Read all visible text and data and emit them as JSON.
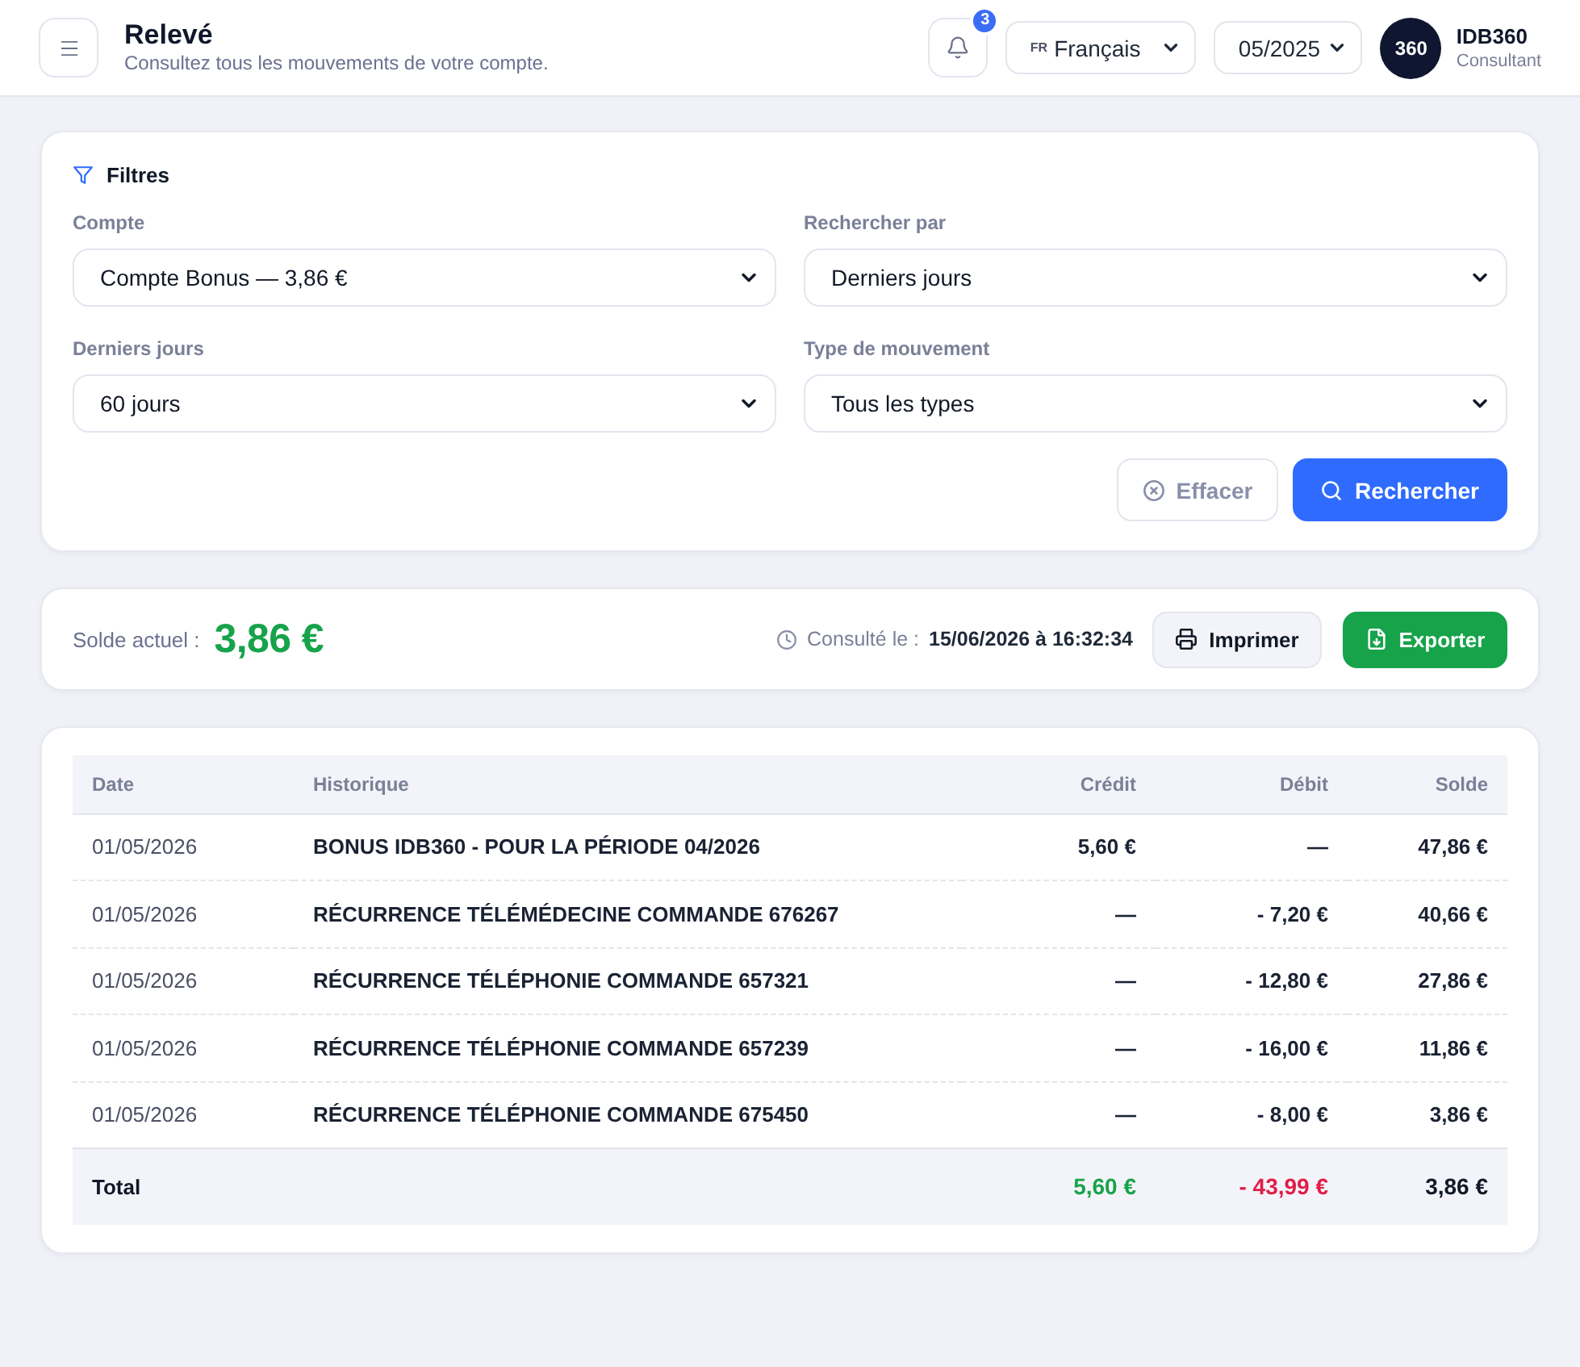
{
  "header": {
    "title": "Relevé",
    "subtitle": "Consultez tous les mouvements de votre compte.",
    "notifications": {
      "count": "3"
    },
    "language": {
      "code": "FR",
      "value": "Français"
    },
    "period": {
      "value": "05/2025"
    },
    "user": {
      "avatar": "360",
      "name": "IDB360",
      "role": "Consultant"
    }
  },
  "filters": {
    "title": "Filtres",
    "fields": [
      {
        "label": "Compte",
        "value": "Compte Bonus — 3,86 €"
      },
      {
        "label": "Rechercher par",
        "value": "Derniers jours"
      },
      {
        "label": "Derniers jours",
        "value": "60 jours"
      },
      {
        "label": "Type de mouvement",
        "value": "Tous les types"
      }
    ],
    "buttons": [
      {
        "label": "Effacer",
        "kind": "clear"
      },
      {
        "label": "Rechercher",
        "kind": "search"
      }
    ]
  },
  "balance": {
    "label": "Solde actuel :",
    "amount": "3,86 €",
    "consulted_label": "Consulté le :",
    "consulted_at": "15/06/2026 à 16:32:34",
    "buttons": [
      {
        "label": "Imprimer",
        "kind": "print"
      },
      {
        "label": "Exporter",
        "kind": "export"
      }
    ]
  },
  "table": {
    "columns": [
      "Date",
      "Historique",
      "Crédit",
      "Débit",
      "Solde"
    ],
    "rows": [
      {
        "date": "01/05/2026",
        "description": "BONUS IDB360 - POUR LA PÉRIODE 04/2026",
        "credit": "5,60 €",
        "debit": "—",
        "balance": "47,86 €"
      },
      {
        "date": "01/05/2026",
        "description": "RÉCURRENCE TÉLÉMÉDECINE COMMANDE 676267",
        "credit": "—",
        "debit": "- 7,20 €",
        "balance": "40,66 €"
      },
      {
        "date": "01/05/2026",
        "description": "RÉCURRENCE TÉLÉPHONIE COMMANDE 657321",
        "credit": "—",
        "debit": "- 12,80 €",
        "balance": "27,86 €"
      },
      {
        "date": "01/05/2026",
        "description": "RÉCURRENCE TÉLÉPHONIE COMMANDE 657239",
        "credit": "—",
        "debit": "- 16,00 €",
        "balance": "11,86 €"
      },
      {
        "date": "01/05/2026",
        "description": "RÉCURRENCE TÉLÉPHONIE COMMANDE 675450",
        "credit": "—",
        "debit": "- 8,00 €",
        "balance": "3,86 €"
      }
    ],
    "total": {
      "label": "Total",
      "credit": "5,60 €",
      "debit": "- 43,99 €",
      "balance": "3,86 €"
    }
  }
}
